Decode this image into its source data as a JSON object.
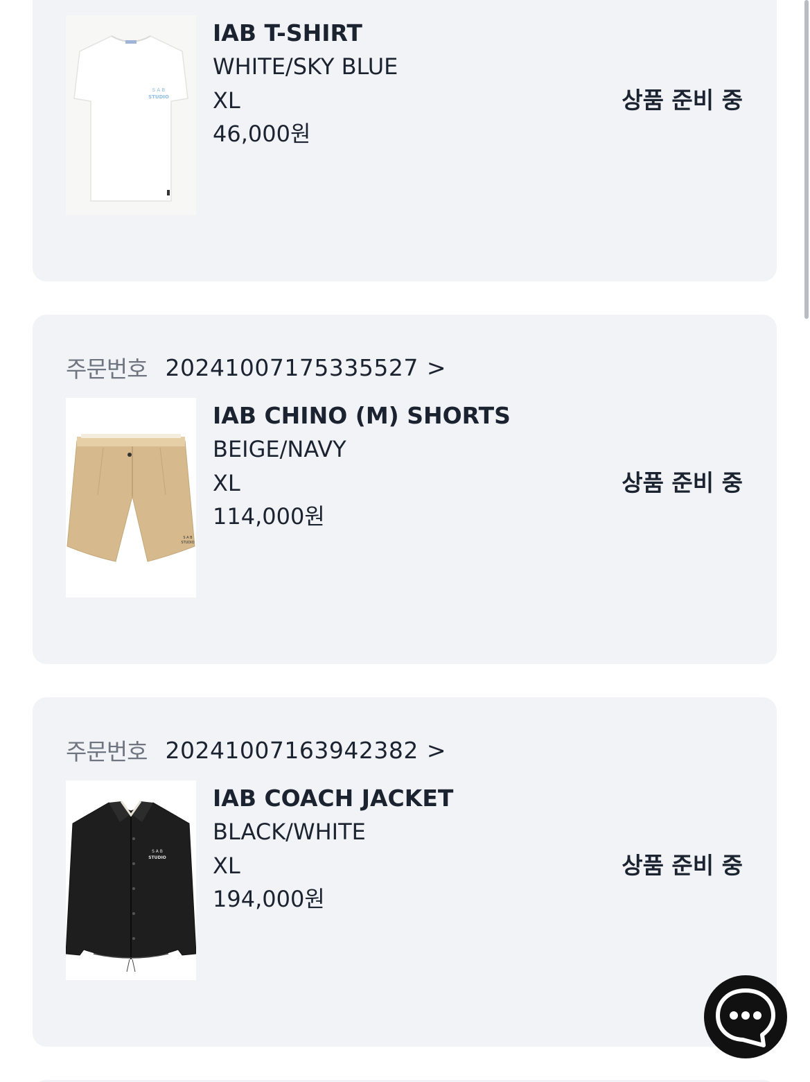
{
  "orders": [
    {
      "product": {
        "name": "IAB T-SHIRT",
        "color": "WHITE/SKY BLUE",
        "size": "XL",
        "price": "46,000원",
        "image_icon": "tshirt-thumbnail"
      },
      "status": "상품 준비 중"
    },
    {
      "order_label": "주문번호",
      "order_number": "20241007175335527",
      "order_arrow": ">",
      "product": {
        "name": "IAB CHINO (M) SHORTS",
        "color": "BEIGE/NAVY",
        "size": "XL",
        "price": "114,000원",
        "image_icon": "shorts-thumbnail"
      },
      "status": "상품 준비 중"
    },
    {
      "order_label": "주문번호",
      "order_number": "20241007163942382",
      "order_arrow": ">",
      "product": {
        "name": "IAB COACH JACKET",
        "color": "BLACK/WHITE",
        "size": "XL",
        "price": "194,000원",
        "image_icon": "jacket-thumbnail"
      },
      "status": "상품 준비 중"
    }
  ],
  "chat": {
    "icon": "chat-bubble-icon"
  },
  "colors": {
    "card_background": "#f2f3f6",
    "text_primary": "#1c2330",
    "text_secondary": "#6f7580",
    "chat_button": "#111111"
  }
}
